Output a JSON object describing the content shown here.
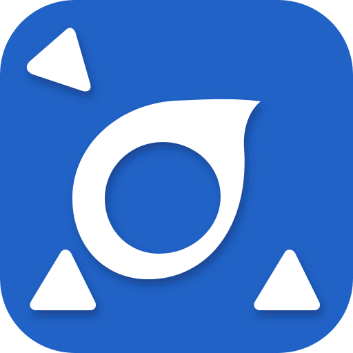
{
  "app_icon": {
    "icon_name": "app-launcher-icon",
    "background_color": "#2162C6",
    "glyph_color": "#FFFFFF",
    "shadow_color": "#0A2E6B",
    "glyphs": {
      "ring": "ring-teardrop-icon",
      "top_left": "triangle-icon",
      "bottom_left": "triangle-icon",
      "bottom_right": "triangle-icon"
    }
  }
}
